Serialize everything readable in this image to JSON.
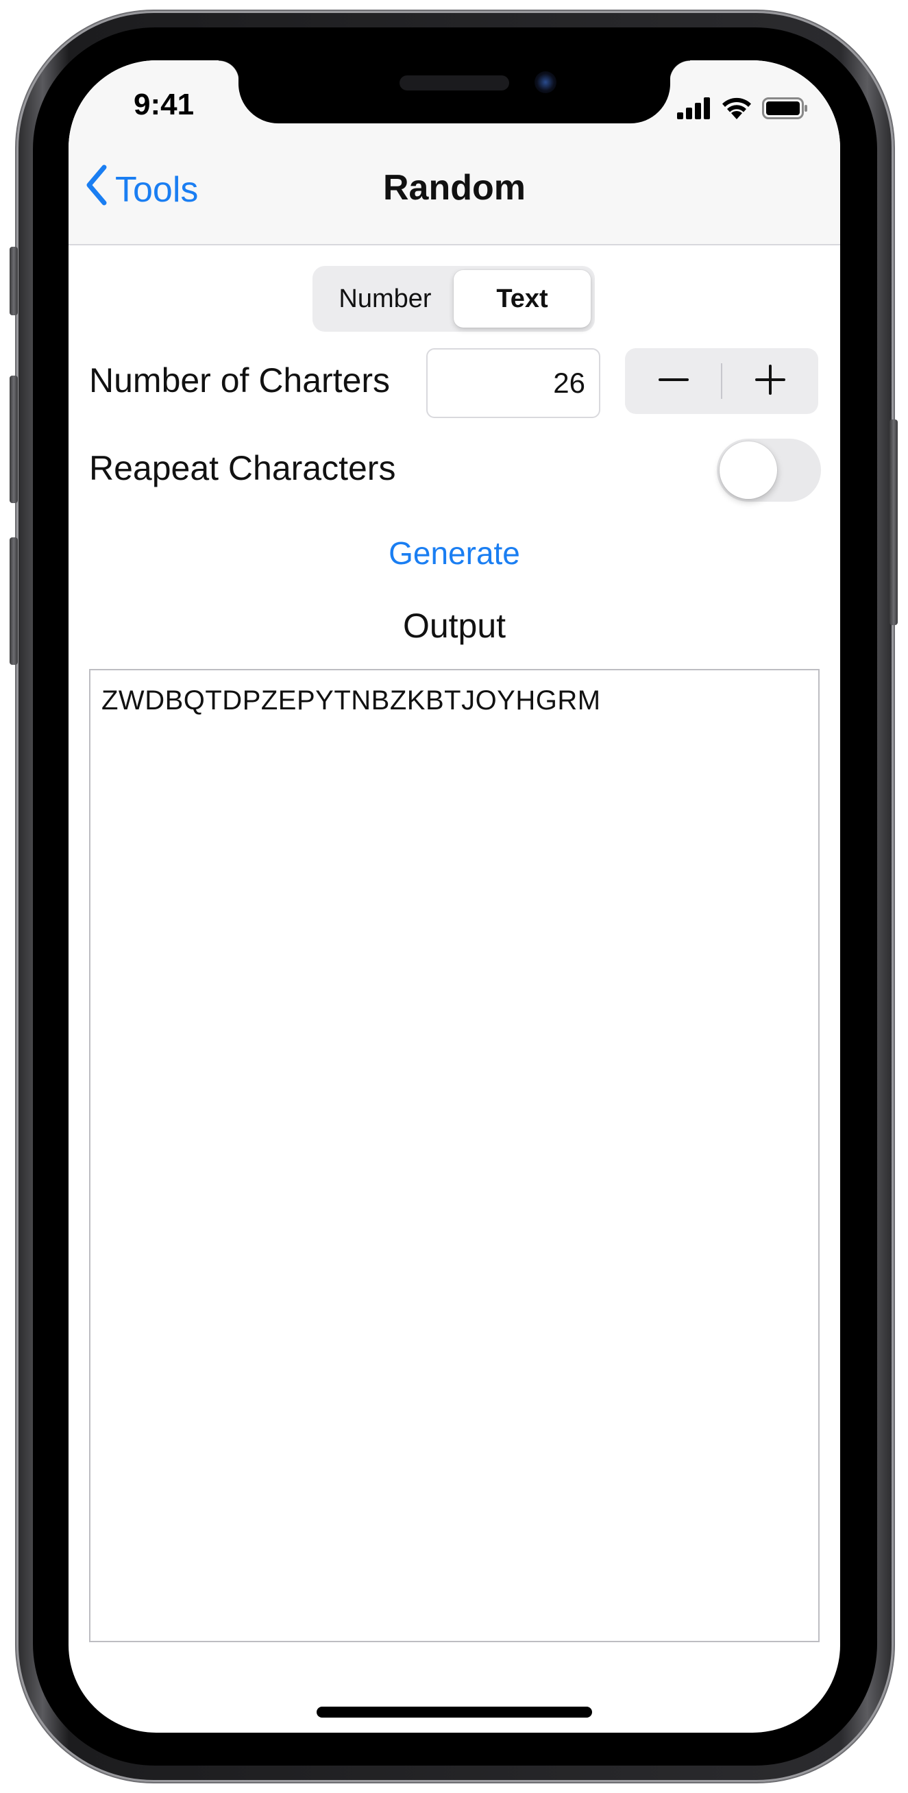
{
  "status_bar": {
    "time": "9:41",
    "icons": [
      "cellular-signal-icon",
      "wifi-icon",
      "battery-icon"
    ]
  },
  "nav": {
    "back_label": "Tools",
    "title": "Random"
  },
  "segmented_control": {
    "options": [
      "Number",
      "Text"
    ],
    "selected": "Text"
  },
  "charters": {
    "label": "Number of Charters",
    "value": "26",
    "stepper_minus": "−",
    "stepper_plus": "+"
  },
  "repeat": {
    "label": "Reapeat Characters",
    "enabled": false
  },
  "generate_label": "Generate",
  "output": {
    "label": "Output",
    "text": "ZWDBQTDPZEPYTNBZKBTJOYHGRM"
  },
  "colors": {
    "accent": "#1a7ef2",
    "nav_background": "#f7f7f7",
    "control_background": "#ececee"
  }
}
